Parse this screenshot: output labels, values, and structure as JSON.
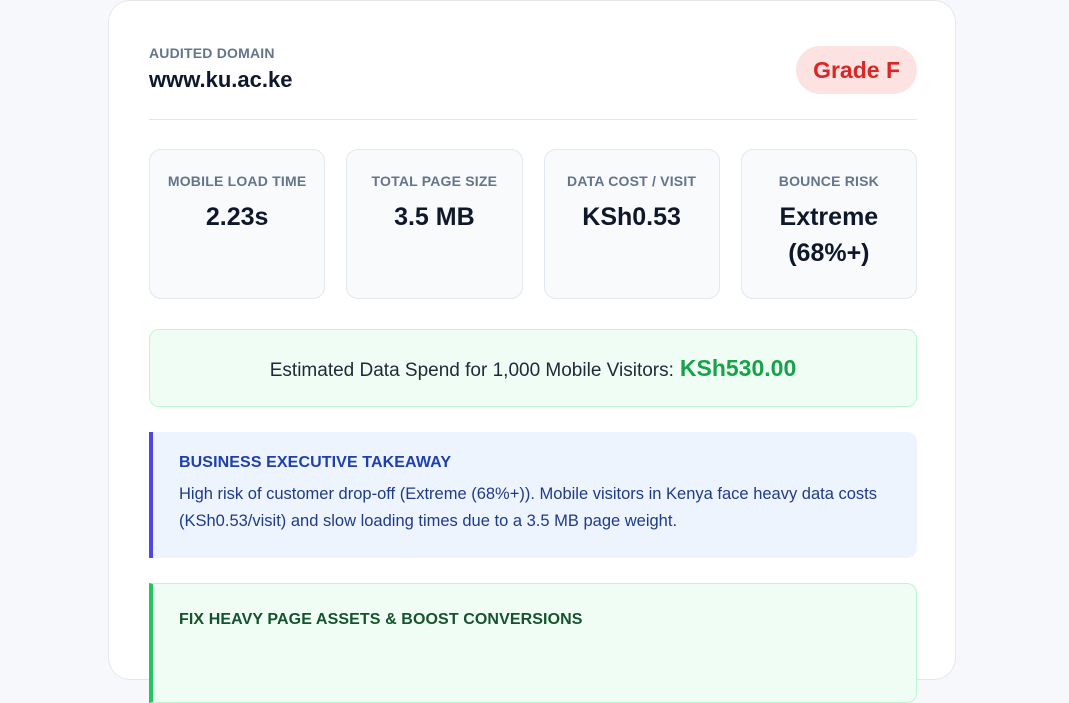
{
  "header": {
    "domain_label": "AUDITED DOMAIN",
    "domain_value": "www.ku.ac.ke",
    "grade": "Grade F"
  },
  "metrics": [
    {
      "label": "MOBILE LOAD TIME",
      "value": "2.23s"
    },
    {
      "label": "TOTAL PAGE SIZE",
      "value": "3.5 MB"
    },
    {
      "label": "DATA COST / VISIT",
      "value": "KSh0.53"
    },
    {
      "label": "BOUNCE RISK",
      "value": "Extreme (68%+)"
    }
  ],
  "spend": {
    "text": "Estimated Data Spend for 1,000 Mobile Visitors:",
    "amount": "KSh530.00"
  },
  "takeaway": {
    "title": "BUSINESS EXECUTIVE TAKEAWAY",
    "text": "High risk of customer drop-off (Extreme (68%+)). Mobile visitors in Kenya face heavy data costs (KSh0.53/visit) and slow loading times due to a 3.5 MB page weight."
  },
  "fix": {
    "title": "FIX HEAVY PAGE ASSETS & BOOST CONVERSIONS"
  },
  "colors": {
    "grade_bg": "#fde2e2",
    "grade_text": "#dc2626",
    "spend_amount": "#16a34a",
    "takeaway_accent": "#4f46e5",
    "fix_accent": "#22c55e"
  }
}
